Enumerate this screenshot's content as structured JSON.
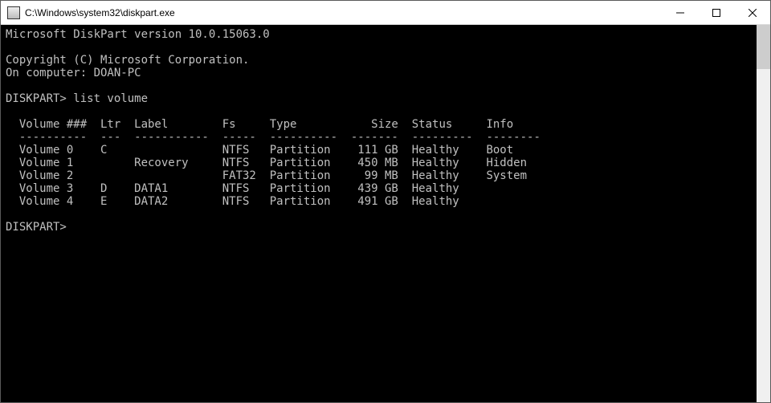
{
  "window": {
    "title": "C:\\Windows\\system32\\diskpart.exe"
  },
  "terminal": {
    "version_line": "Microsoft DiskPart version 10.0.15063.0",
    "copyright_line": "Copyright (C) Microsoft Corporation.",
    "computer_line": "On computer: DOAN-PC",
    "prompt": "DISKPART>",
    "command1": "list volume",
    "table": {
      "headers": {
        "volume": "Volume ###",
        "ltr": "Ltr",
        "label": "Label",
        "fs": "Fs",
        "type": "Type",
        "size": "Size",
        "status": "Status",
        "info": "Info"
      },
      "divider": {
        "volume": "----------",
        "ltr": "---",
        "label": "-----------",
        "fs": "-----",
        "type": "----------",
        "size": "-------",
        "status": "---------",
        "info": "--------"
      },
      "rows": [
        {
          "volume": "Volume 0",
          "ltr": "C",
          "label": "",
          "fs": "NTFS",
          "type": "Partition",
          "size": "111 GB",
          "status": "Healthy",
          "info": "Boot"
        },
        {
          "volume": "Volume 1",
          "ltr": "",
          "label": "Recovery",
          "fs": "NTFS",
          "type": "Partition",
          "size": "450 MB",
          "status": "Healthy",
          "info": "Hidden"
        },
        {
          "volume": "Volume 2",
          "ltr": "",
          "label": "",
          "fs": "FAT32",
          "type": "Partition",
          "size": "99 MB",
          "status": "Healthy",
          "info": "System"
        },
        {
          "volume": "Volume 3",
          "ltr": "D",
          "label": "DATA1",
          "fs": "NTFS",
          "type": "Partition",
          "size": "439 GB",
          "status": "Healthy",
          "info": ""
        },
        {
          "volume": "Volume 4",
          "ltr": "E",
          "label": "DATA2",
          "fs": "NTFS",
          "type": "Partition",
          "size": "491 GB",
          "status": "Healthy",
          "info": ""
        }
      ]
    }
  }
}
